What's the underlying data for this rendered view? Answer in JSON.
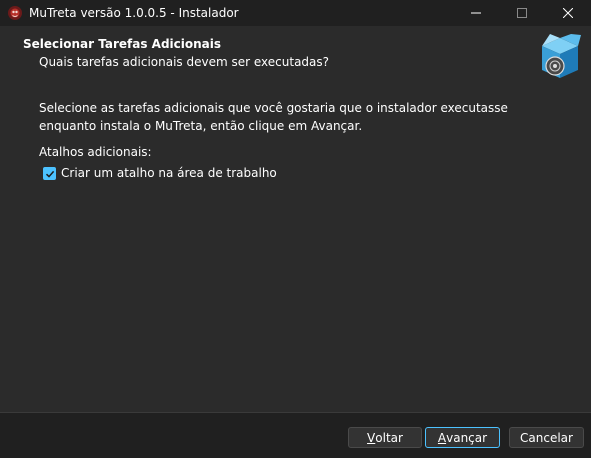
{
  "window": {
    "title": "MuTreta versão 1.0.0.5 - Instalador",
    "icon": "mutreta-app-icon",
    "controls": [
      "minimize",
      "maximize",
      "close"
    ]
  },
  "page": {
    "heading": "Selecionar Tarefas Adicionais",
    "subheading": "Quais tarefas adicionais devem ser executadas?",
    "description": "Selecione as tarefas adicionais que você gostaria que o instalador executasse enquanto instala o MuTreta, então clique em Avançar.",
    "group_label": "Atalhos adicionais:",
    "tasks": [
      {
        "label": "Criar um atalho na área de trabalho",
        "checked": true
      }
    ],
    "wizard_image": "software-box-with-disc-icon"
  },
  "buttons": {
    "back": {
      "label": "Voltar",
      "accel_char": "V",
      "rest": "oltar"
    },
    "next": {
      "label": "Avançar",
      "accel_char": "A",
      "rest": "vançar"
    },
    "cancel": {
      "label": "Cancelar"
    }
  },
  "colors": {
    "accent": "#4cc2ff",
    "background": "#2b2b2b",
    "titlebar": "#202020"
  }
}
